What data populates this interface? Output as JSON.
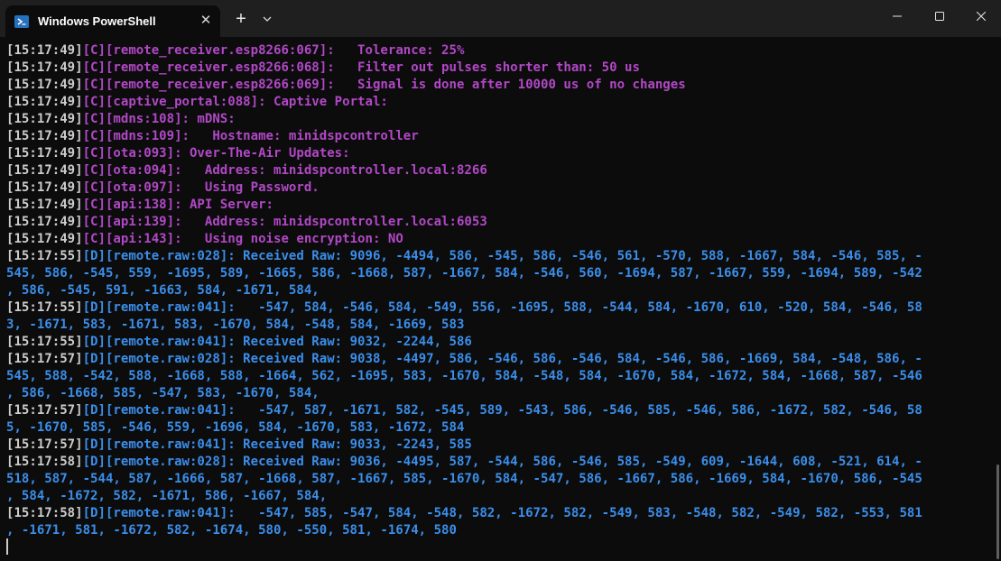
{
  "window": {
    "tab_title": "Windows PowerShell",
    "tab_close_glyph": "✕",
    "new_tab_glyph": "+",
    "colors": {
      "titlebar": "#1f1f1f",
      "background": "#0c0c0c",
      "timestamp": "#cccccc",
      "config_tag": "#b148c6",
      "debug_tag": "#3b8eea"
    }
  },
  "terminal": {
    "lines": [
      {
        "ts": "[15:17:49]",
        "tag": "[C]",
        "msg": "[remote_receiver.esp8266:067]:   Tolerance: 25%"
      },
      {
        "ts": "[15:17:49]",
        "tag": "[C]",
        "msg": "[remote_receiver.esp8266:068]:   Filter out pulses shorter than: 50 us"
      },
      {
        "ts": "[15:17:49]",
        "tag": "[C]",
        "msg": "[remote_receiver.esp8266:069]:   Signal is done after 10000 us of no changes"
      },
      {
        "ts": "[15:17:49]",
        "tag": "[C]",
        "msg": "[captive_portal:088]: Captive Portal:"
      },
      {
        "ts": "[15:17:49]",
        "tag": "[C]",
        "msg": "[mdns:108]: mDNS:"
      },
      {
        "ts": "[15:17:49]",
        "tag": "[C]",
        "msg": "[mdns:109]:   Hostname: minidspcontroller"
      },
      {
        "ts": "[15:17:49]",
        "tag": "[C]",
        "msg": "[ota:093]: Over-The-Air Updates:"
      },
      {
        "ts": "[15:17:49]",
        "tag": "[C]",
        "msg": "[ota:094]:   Address: minidspcontroller.local:8266"
      },
      {
        "ts": "[15:17:49]",
        "tag": "[C]",
        "msg": "[ota:097]:   Using Password."
      },
      {
        "ts": "[15:17:49]",
        "tag": "[C]",
        "msg": "[api:138]: API Server:"
      },
      {
        "ts": "[15:17:49]",
        "tag": "[C]",
        "msg": "[api:139]:   Address: minidspcontroller.local:6053"
      },
      {
        "ts": "[15:17:49]",
        "tag": "[C]",
        "msg": "[api:143]:   Using noise encryption: NO"
      },
      {
        "ts": "[15:17:55]",
        "tag": "[D]",
        "msg": "[remote.raw:028]: Received Raw: 9096, -4494, 586, -545, 586, -546, 561, -570, 588, -1667, 584, -546, 585, -"
      },
      {
        "ts": "",
        "tag": "",
        "msg": "545, 586, -545, 559, -1695, 589, -1665, 586, -1668, 587, -1667, 584, -546, 560, -1694, 587, -1667, 559, -1694, 589, -542"
      },
      {
        "ts": "",
        "tag": "",
        "msg": ", 586, -545, 591, -1663, 584, -1671, 584,"
      },
      {
        "ts": "[15:17:55]",
        "tag": "[D]",
        "msg": "[remote.raw:041]:   -547, 584, -546, 584, -549, 556, -1695, 588, -544, 584, -1670, 610, -520, 584, -546, 58"
      },
      {
        "ts": "",
        "tag": "",
        "msg": "3, -1671, 583, -1671, 583, -1670, 584, -548, 584, -1669, 583"
      },
      {
        "ts": "[15:17:55]",
        "tag": "[D]",
        "msg": "[remote.raw:041]: Received Raw: 9032, -2244, 586"
      },
      {
        "ts": "[15:17:57]",
        "tag": "[D]",
        "msg": "[remote.raw:028]: Received Raw: 9038, -4497, 586, -546, 586, -546, 584, -546, 586, -1669, 584, -548, 586, -"
      },
      {
        "ts": "",
        "tag": "",
        "msg": "545, 588, -542, 588, -1668, 588, -1664, 562, -1695, 583, -1670, 584, -548, 584, -1670, 584, -1672, 584, -1668, 587, -546"
      },
      {
        "ts": "",
        "tag": "",
        "msg": ", 586, -1668, 585, -547, 583, -1670, 584,"
      },
      {
        "ts": "[15:17:57]",
        "tag": "[D]",
        "msg": "[remote.raw:041]:   -547, 587, -1671, 582, -545, 589, -543, 586, -546, 585, -546, 586, -1672, 582, -546, 58"
      },
      {
        "ts": "",
        "tag": "",
        "msg": "5, -1670, 585, -546, 559, -1696, 584, -1670, 583, -1672, 584"
      },
      {
        "ts": "[15:17:57]",
        "tag": "[D]",
        "msg": "[remote.raw:041]: Received Raw: 9033, -2243, 585"
      },
      {
        "ts": "[15:17:58]",
        "tag": "[D]",
        "msg": "[remote.raw:028]: Received Raw: 9036, -4495, 587, -544, 586, -546, 585, -549, 609, -1644, 608, -521, 614, -"
      },
      {
        "ts": "",
        "tag": "",
        "msg": "518, 587, -544, 587, -1666, 587, -1668, 587, -1667, 585, -1670, 584, -547, 586, -1667, 586, -1669, 584, -1670, 586, -545"
      },
      {
        "ts": "",
        "tag": "",
        "msg": ", 584, -1672, 582, -1671, 586, -1667, 584,"
      },
      {
        "ts": "[15:17:58]",
        "tag": "[D]",
        "msg": "[remote.raw:041]:   -547, 585, -547, 584, -548, 582, -1672, 582, -549, 583, -548, 582, -549, 582, -553, 581"
      },
      {
        "ts": "",
        "tag": "",
        "msg": ", -1671, 581, -1672, 582, -1674, 580, -550, 581, -1674, 580"
      }
    ]
  }
}
